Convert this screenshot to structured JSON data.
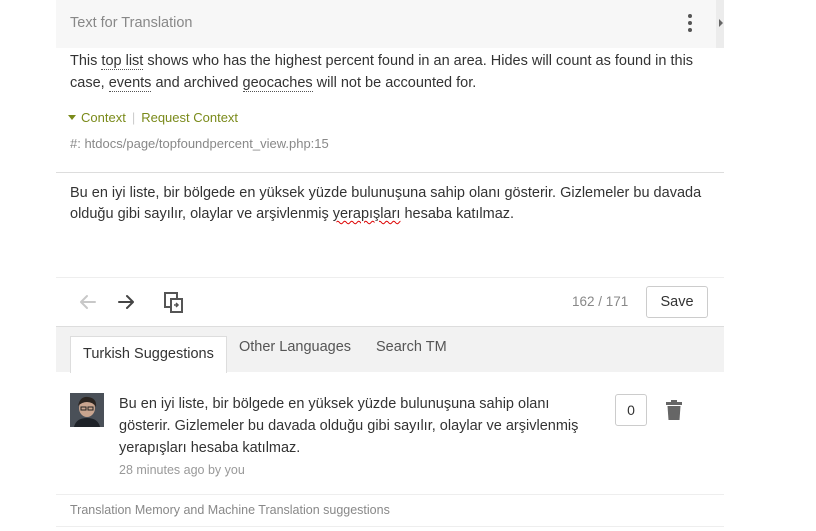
{
  "header": {
    "title": "Text for Translation",
    "menu_icon": "kebab-menu-icon"
  },
  "source": {
    "p1": "This ",
    "t1": "top list",
    "p2": " shows who has the highest percent found in an area. Hides will count as found in this case, ",
    "t2": "events",
    "p3": " and archived ",
    "t3": "geocaches",
    "p4": " will not be accounted for."
  },
  "context": {
    "toggle_label": "Context",
    "request_label": "Request Context",
    "reference": "#: htdocs/page/topfoundpercent_view.php:15"
  },
  "translation": {
    "before": "Bu en iyi liste, bir bölgede en yüksek yüzde bulunuşuna sahip olanı gösterir. Gizlemeler bu davada olduğu gibi sayılır, olaylar ve arşivlenmiş ",
    "misspelled": "yerapışları",
    "after": " hesaba katılmaz."
  },
  "toolbar": {
    "prev_icon": "arrow-left-icon",
    "next_icon": "arrow-right-icon",
    "copy_icon": "copy-original-icon",
    "counter": "162 / 171",
    "save_label": "Save"
  },
  "tabs": [
    {
      "label": "Turkish Suggestions",
      "active": true
    },
    {
      "label": "Other Languages",
      "active": false
    },
    {
      "label": "Search TM",
      "active": false
    }
  ],
  "suggestion": {
    "text": "Bu en iyi liste, bir bölgede en yüksek yüzde bulunuşuna sahip olanı gösterir. Gizlemeler bu davada olduğu gibi sayılır, olaylar ve arşivlenmiş yerapışları hesaba katılmaz.",
    "meta": "28 minutes ago by you",
    "votes": "0",
    "delete_icon": "trash-icon"
  },
  "footer": {
    "note": "Translation Memory and Machine Translation suggestions"
  },
  "colors": {
    "accent_green": "#7a8a1a",
    "spell_error": "#dd0000"
  }
}
